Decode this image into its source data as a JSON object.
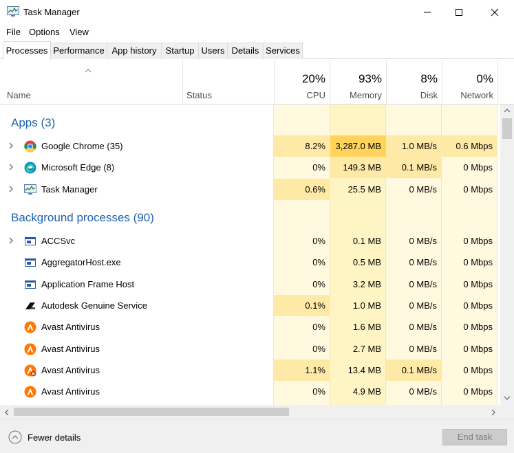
{
  "window": {
    "title": "Task Manager",
    "controls": [
      "minimize-icon",
      "maximize-icon",
      "close-icon"
    ]
  },
  "menu": [
    "File",
    "Options",
    "View"
  ],
  "tabs": [
    {
      "label": "Processes",
      "active": true
    },
    {
      "label": "Performance"
    },
    {
      "label": "App history"
    },
    {
      "label": "Startup"
    },
    {
      "label": "Users"
    },
    {
      "label": "Details"
    },
    {
      "label": "Services"
    }
  ],
  "columns": {
    "name": "Name",
    "status": "Status",
    "cpu": {
      "pct": "20%",
      "label": "CPU"
    },
    "memory": {
      "pct": "93%",
      "label": "Memory"
    },
    "disk": {
      "pct": "8%",
      "label": "Disk"
    },
    "network": {
      "pct": "0%",
      "label": "Network"
    }
  },
  "sections": {
    "apps": "Apps (3)",
    "background": "Background processes (90)"
  },
  "apps": [
    {
      "name": "Google Chrome (35)",
      "icon": "chrome-icon",
      "cpu": "8.2%",
      "memory": "3,287.0 MB",
      "disk": "1.0 MB/s",
      "network": "0.6 Mbps"
    },
    {
      "name": "Microsoft Edge (8)",
      "icon": "edge-icon",
      "cpu": "0%",
      "memory": "149.3 MB",
      "disk": "0.1 MB/s",
      "network": "0 Mbps"
    },
    {
      "name": "Task Manager",
      "icon": "task-manager-icon",
      "cpu": "0.6%",
      "memory": "25.5 MB",
      "disk": "0 MB/s",
      "network": "0 Mbps"
    }
  ],
  "background": [
    {
      "name": "ACCSvc",
      "icon": "service-window-icon",
      "cpu": "0%",
      "memory": "0.1 MB",
      "disk": "0 MB/s",
      "network": "0 Mbps"
    },
    {
      "name": "AggregatorHost.exe",
      "icon": "service-window-icon",
      "cpu": "0%",
      "memory": "0.5 MB",
      "disk": "0 MB/s",
      "network": "0 Mbps"
    },
    {
      "name": "Application Frame Host",
      "icon": "service-window-icon",
      "cpu": "0%",
      "memory": "3.2 MB",
      "disk": "0 MB/s",
      "network": "0 Mbps"
    },
    {
      "name": "Autodesk Genuine Service",
      "icon": "autodesk-icon",
      "cpu": "0.1%",
      "memory": "1.0 MB",
      "disk": "0 MB/s",
      "network": "0 Mbps"
    },
    {
      "name": "Avast Antivirus",
      "icon": "avast-icon",
      "cpu": "0%",
      "memory": "1.6 MB",
      "disk": "0 MB/s",
      "network": "0 Mbps"
    },
    {
      "name": "Avast Antivirus",
      "icon": "avast-icon",
      "cpu": "0%",
      "memory": "2.7 MB",
      "disk": "0 MB/s",
      "network": "0 Mbps"
    },
    {
      "name": "Avast Antivirus",
      "icon": "avast-alert-icon",
      "cpu": "1.1%",
      "memory": "13.4 MB",
      "disk": "0.1 MB/s",
      "network": "0 Mbps"
    },
    {
      "name": "Avast Antivirus",
      "icon": "avast-icon",
      "cpu": "0%",
      "memory": "4.9 MB",
      "disk": "0 MB/s",
      "network": "0 Mbps"
    }
  ],
  "footer": {
    "fewer_details": "Fewer details",
    "end_task": "End task"
  },
  "colors": {
    "section_blue": "#1e61b0",
    "heat_light": "#fff4c4",
    "heat_medium": "#ffe9a7",
    "heat_high": "#ffd35c",
    "col_bg": "#fff9e0"
  }
}
